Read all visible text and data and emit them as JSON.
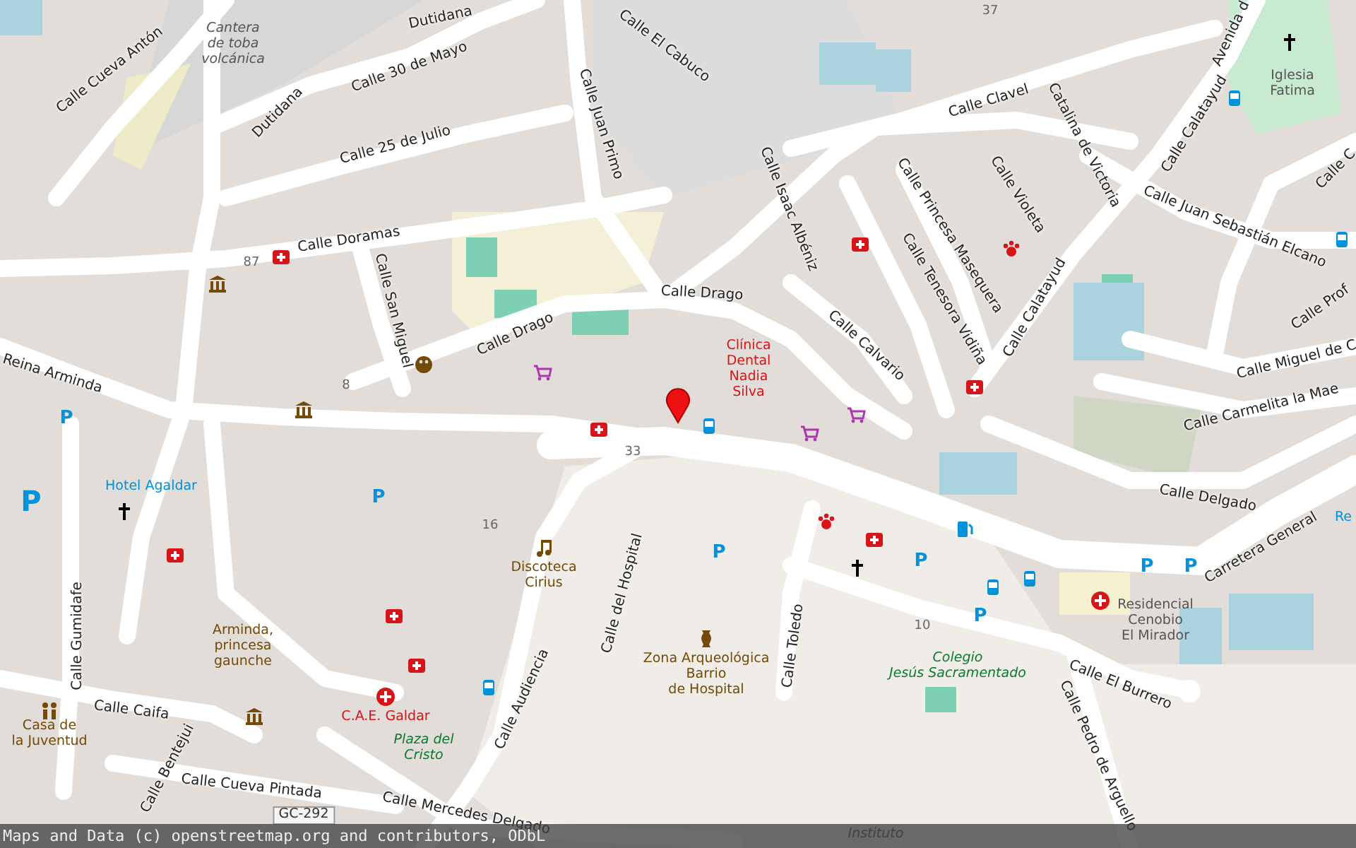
{
  "map": {
    "streets": [
      "Calle Cueva Antón",
      "Dutidana",
      "Dutidana",
      "Calle 30 de Mayo",
      "Calle 25 de Julio",
      "Calle Juan Primo",
      "Calle El Cabuco",
      "Calle Doramas",
      "Calle San Miguel",
      "Calle Drago",
      "Calle Drago",
      "Calle Isaac Albéniz",
      "Calle Calvario",
      "Reina Arminda",
      "Calle Clavel",
      "Catalina de Victoria",
      "Calle Violeta",
      "Calle Princesa Masequera",
      "Calle Tenesora Vidiña",
      "Calle Calatayud",
      "Calle Calatayud",
      "Avenida d",
      "Calle Juan Sebastián Elcano",
      "Calle C",
      "Calle Prof",
      "Calle Miguel de C",
      "Calle Carmelita la Mae",
      "Calle Delgado",
      "Carretera General",
      "Calle Gumidafe",
      "Calle Caifa",
      "Calle Bentejui",
      "Calle Cueva Pintada",
      "Calle Mercedes Delgado",
      "Calle Audiencia",
      "Calle del Hospital",
      "Calle Toledo",
      "Calle El Burrero",
      "Calle Pedro de Arguello"
    ],
    "places": [
      {
        "name": "Cantera\nde toba\nvolcánica",
        "kind": "natural"
      },
      {
        "name": "Clínica\nDental\nNadia\nSilva",
        "kind": "health"
      },
      {
        "name": "Iglesia\nFatima",
        "kind": "building"
      },
      {
        "name": "Hotel Agaldar",
        "kind": "hotel"
      },
      {
        "name": "Arminda,\nprincesa\ngaunche",
        "kind": "poi"
      },
      {
        "name": "Casa de\nla Juventud",
        "kind": "poi"
      },
      {
        "name": "C.A.E. Galdar",
        "kind": "health"
      },
      {
        "name": "Plaza del\nCristo",
        "kind": "park"
      },
      {
        "name": "Discoteca\nCirius",
        "kind": "poi"
      },
      {
        "name": "Zona Arqueológica\nBarrio\nde Hospital",
        "kind": "poi"
      },
      {
        "name": "Colegio\nJesús Sacramentado",
        "kind": "park"
      },
      {
        "name": "Residencial\nCenobio\nEl Mirador",
        "kind": "building"
      },
      {
        "name": "Instituto",
        "kind": "natural"
      },
      {
        "name": "Re",
        "kind": "hotel"
      }
    ],
    "house_numbers": [
      "87",
      "8",
      "33",
      "16",
      "10",
      "37"
    ],
    "parking": [
      "P",
      "P",
      "P",
      "P",
      "P",
      "P",
      "P",
      "P"
    ],
    "road_shield": "GC-292",
    "attribution": "Maps and Data (c) openstreetmap.org and contributors, ODbL"
  }
}
